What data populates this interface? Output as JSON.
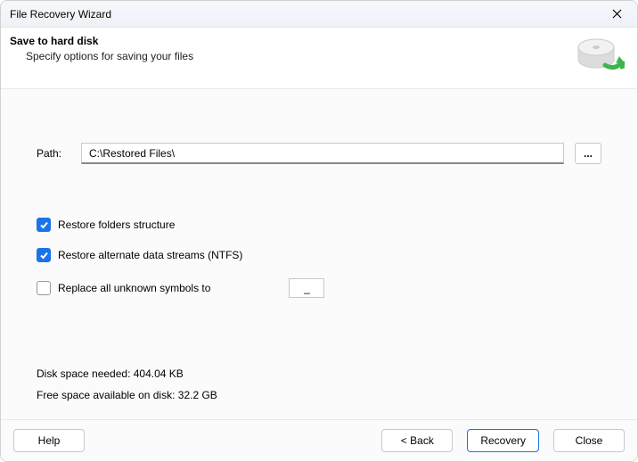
{
  "window": {
    "title": "File Recovery Wizard"
  },
  "header": {
    "title": "Save to hard disk",
    "subtitle": "Specify options for saving your files",
    "icon": "harddisk-save-icon"
  },
  "path": {
    "label": "Path:",
    "value": "C:\\Restored Files\\",
    "browse_label": "..."
  },
  "options": {
    "restore_folders": {
      "checked": true,
      "label": "Restore folders structure"
    },
    "restore_ads": {
      "checked": true,
      "label": "Restore alternate data streams (NTFS)"
    },
    "replace_symbols": {
      "checked": false,
      "label": "Replace all unknown symbols to",
      "value": "_"
    }
  },
  "disk": {
    "needed_label": "Disk space needed:",
    "needed_value": "404.04 KB",
    "free_label": "Free space available on disk:",
    "free_value": "32.2 GB"
  },
  "footer": {
    "help": "Help",
    "back": "< Back",
    "recovery": "Recovery",
    "close": "Close"
  }
}
